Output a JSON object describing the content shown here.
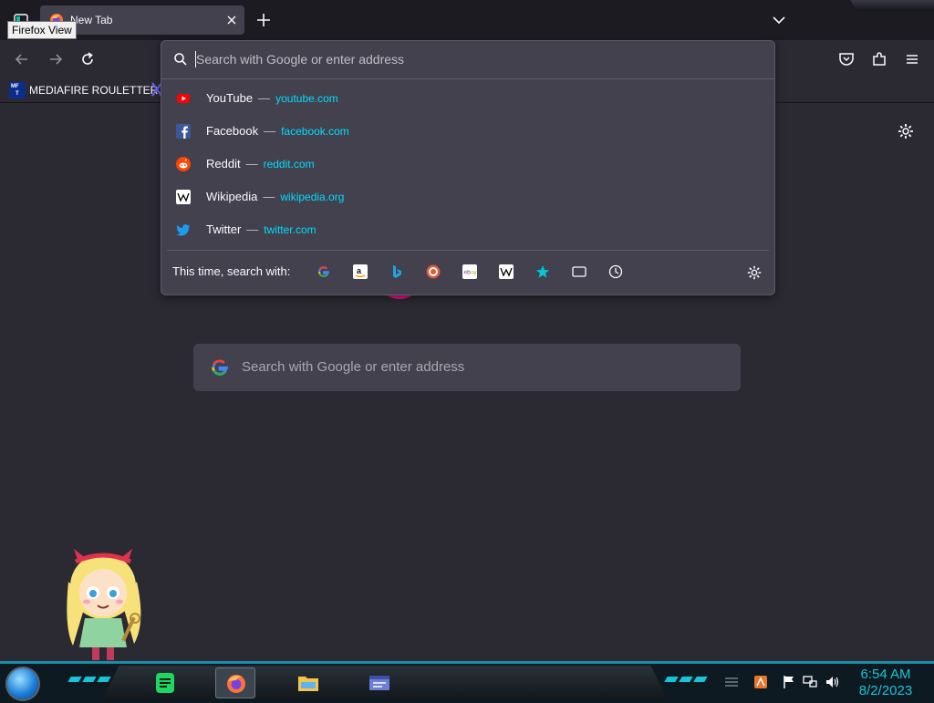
{
  "tooltip": "Firefox View",
  "tab": {
    "title": "New Tab"
  },
  "bookmarks": [
    {
      "label": "MEDIAFIRE ROULETTER",
      "icon_text": [
        "MF",
        "T"
      ]
    }
  ],
  "urlbar": {
    "placeholder": "Search with Google or enter address",
    "suggestions": [
      {
        "name": "YouTube",
        "url": "youtube.com",
        "icon": "youtube-icon"
      },
      {
        "name": "Facebook",
        "url": "facebook.com",
        "icon": "facebook-icon"
      },
      {
        "name": "Reddit",
        "url": "reddit.com",
        "icon": "reddit-icon"
      },
      {
        "name": "Wikipedia",
        "url": "wikipedia.org",
        "icon": "wikipedia-icon"
      },
      {
        "name": "Twitter",
        "url": "twitter.com",
        "icon": "twitter-icon"
      }
    ],
    "separator": "—",
    "one_off_label": "This time, search with:",
    "engines": [
      "google-icon",
      "amazon-icon",
      "bing-icon",
      "duckduckgo-icon",
      "ebay-icon",
      "wikipedia-icon",
      "bookmarks-star-icon",
      "tabs-icon",
      "history-icon"
    ]
  },
  "newtab": {
    "search_placeholder": "Search with Google or enter address"
  },
  "taskbar": {
    "apps": [
      "sheets-app-icon",
      "firefox-icon",
      "file-explorer-icon",
      "window-app-icon"
    ],
    "clock_time": "6:54 AM",
    "clock_date": "8/2/2023"
  },
  "colors": {
    "accent_url": "#00ddff",
    "bg": "#2b2a33",
    "popup_bg": "#42414d",
    "taskbar_accent": "#19c3d6",
    "pocket_pink": "#e31587"
  }
}
